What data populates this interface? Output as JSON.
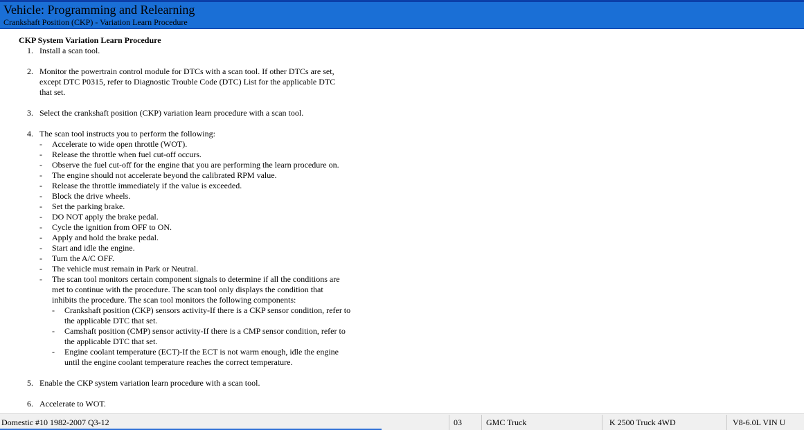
{
  "header": {
    "title": "Vehicle:  Programming and Relearning",
    "subtitle": "Crankshaft Position (CKP) - Variation Learn Procedure"
  },
  "procedure": {
    "title": "CKP System Variation Learn Procedure",
    "steps": [
      {
        "num": "1.",
        "text": "Install a scan tool."
      },
      {
        "num": "2.",
        "text": "Monitor the powertrain control module for DTCs with a scan tool. If other DTCs are set, except DTC P0315, refer to Diagnostic Trouble Code (DTC) List for the applicable DTC that set."
      },
      {
        "num": "3.",
        "text": "Select the crankshaft position (CKP) variation learn procedure with a scan tool."
      },
      {
        "num": "4.",
        "text": "The scan tool instructs you to perform the following:",
        "subs": [
          "Accelerate to wide open throttle (WOT).",
          "Release the throttle when fuel cut-off occurs.",
          "Observe the fuel cut-off for the engine that you are performing the learn procedure on.",
          "The engine should not accelerate beyond the calibrated RPM value.",
          "Release the throttle immediately if the value is exceeded.",
          "Block the drive wheels.",
          "Set the parking brake.",
          "DO NOT apply the brake pedal.",
          "Cycle the ignition from OFF to ON.",
          "Apply and hold the brake pedal.",
          "Start and idle the engine.",
          "Turn the A/C OFF.",
          "The vehicle must remain in Park or Neutral.",
          "The scan tool monitors certain component signals to determine if all the conditions are met to continue with the procedure. The scan tool only displays the condition that inhibits the procedure. The scan tool monitors the following components:"
        ],
        "subsubs": [
          "Crankshaft position (CKP) sensors activity-If there is a CKP sensor condition, refer to the applicable DTC that set.",
          "Camshaft position (CMP) sensor activity-If there is a CMP sensor condition, refer to the applicable DTC that set.",
          "Engine coolant temperature (ECT)-If the ECT is not warm enough, idle the engine until the engine coolant temperature reaches the correct temperature."
        ]
      },
      {
        "num": "5.",
        "text": "Enable the CKP system variation learn procedure with a scan tool."
      },
      {
        "num": "6.",
        "text": "Accelerate to WOT."
      }
    ]
  },
  "status_bar": {
    "database": "Domestic #10 1982-2007 Q3-12",
    "code": "03",
    "make": "GMC Truck",
    "model": "K 2500 Truck 4WD",
    "engine": "V8-6.0L VIN U",
    "progress_fraction": 0.475
  },
  "colors": {
    "header_background": "#1a6fd6",
    "header_border": "#0b3fa8",
    "progress_bar": "#2e6fd6"
  }
}
